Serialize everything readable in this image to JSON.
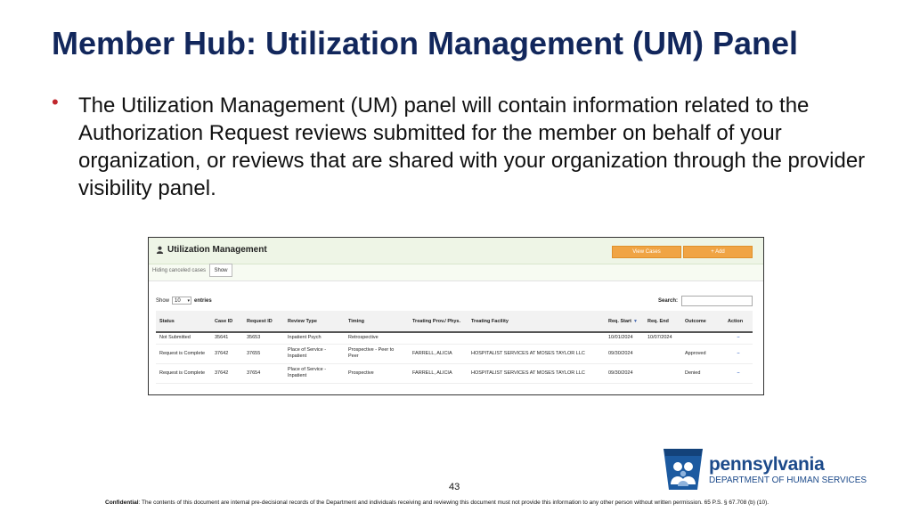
{
  "slide": {
    "title": "Member Hub: Utilization Management (UM) Panel",
    "bullet": "The Utilization Management (UM) panel will contain information related to the Authorization Request reviews submitted for the member on behalf of your organization, or reviews that are shared with your organization through the provider visibility panel.",
    "page_number": "43",
    "confidential_label": "Confidential",
    "confidential_text": ": The contents of this document are internal pre-decisional records of the Department and individuals receiving and reviewing this document must not provide this information to any other person without written permission. 65 P.S. § 67.708 (b) (10)."
  },
  "um_panel": {
    "title": "Utilization Management",
    "view_cases_label": "View Cases",
    "add_label": "+ Add",
    "hiding_text": "Hiding canceled cases",
    "show_button": "Show",
    "show_label": "Show",
    "entries_value": "10",
    "entries_label": "entries",
    "search_label": "Search:",
    "columns": [
      "Status",
      "Case ID",
      "Request ID",
      "Review Type",
      "Timing",
      "Treating Prov./ Phys.",
      "Treating Facility",
      "Req. Start",
      "Req. End",
      "Outcome",
      "Action"
    ],
    "rows": [
      [
        "Not Submitted",
        "35641",
        "35653",
        "Inpatient Psych",
        "Retrospective",
        "",
        "",
        "10/01/2024",
        "10/07/2024",
        "",
        "–"
      ],
      [
        "Request is Complete",
        "37642",
        "37655",
        "Place of Service - Inpatient",
        "Prospective - Peer to Peer",
        "FARRELL, ALICIA",
        "HOSPITALIST SERVICES AT MOSES TAYLOR LLC",
        "09/30/2024",
        "",
        "Approved",
        "–"
      ],
      [
        "Request is Complete",
        "37642",
        "37654",
        "Place of Service - Inpatient",
        "Prospective",
        "FARRELL, ALICIA",
        "HOSPITALIST SERVICES AT MOSES TAYLOR LLC",
        "09/30/2024",
        "",
        "Denied",
        "–"
      ]
    ]
  },
  "logo": {
    "name": "pennsylvania",
    "department": "DEPARTMENT OF HUMAN SERVICES"
  },
  "colors": {
    "title": "#12275c",
    "bullet": "#c0272d",
    "orange_button": "#f0a444",
    "logo_blue": "#1c4a8a"
  }
}
